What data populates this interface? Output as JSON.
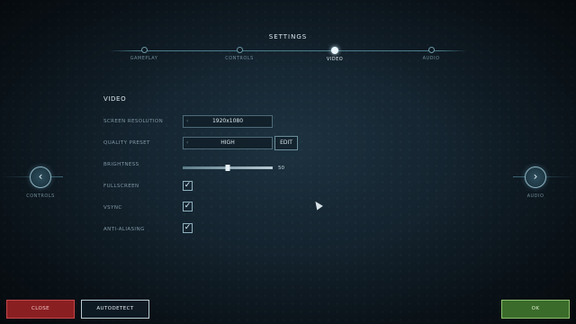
{
  "header": {
    "title": "SETTINGS",
    "steps": [
      {
        "label": "GAMEPLAY"
      },
      {
        "label": "CONTROLS"
      },
      {
        "label": "VIDEO"
      },
      {
        "label": "AUDIO"
      }
    ],
    "active_step": "VIDEO"
  },
  "section": {
    "title": "VIDEO",
    "screen_resolution": {
      "label": "SCREEN RESOLUTION",
      "value": "1920x1080"
    },
    "quality_preset": {
      "label": "QUALITY PRESET",
      "value": "HIGH",
      "edit_label": "EDIT"
    },
    "brightness": {
      "label": "BRIGHTNESS",
      "value": "50",
      "fraction": 0.5
    },
    "fullscreen": {
      "label": "FULLSCREEN",
      "checked": true
    },
    "vsync": {
      "label": "VSYNC",
      "checked": true
    },
    "anti_aliasing": {
      "label": "ANTI-ALIASING",
      "checked": true
    }
  },
  "nav": {
    "prev_label": "CONTROLS",
    "next_label": "AUDIO",
    "prev_icon": "chevron-left-icon",
    "next_icon": "chevron-right-icon"
  },
  "footer": {
    "close_label": "CLOSE",
    "autodetect_label": "AUTODETECT",
    "ok_label": "OK"
  },
  "colors": {
    "close": "#8a1f22",
    "ok": "#3a6b2a",
    "accent": "#8fb6c4"
  },
  "check_glyph": "✓"
}
